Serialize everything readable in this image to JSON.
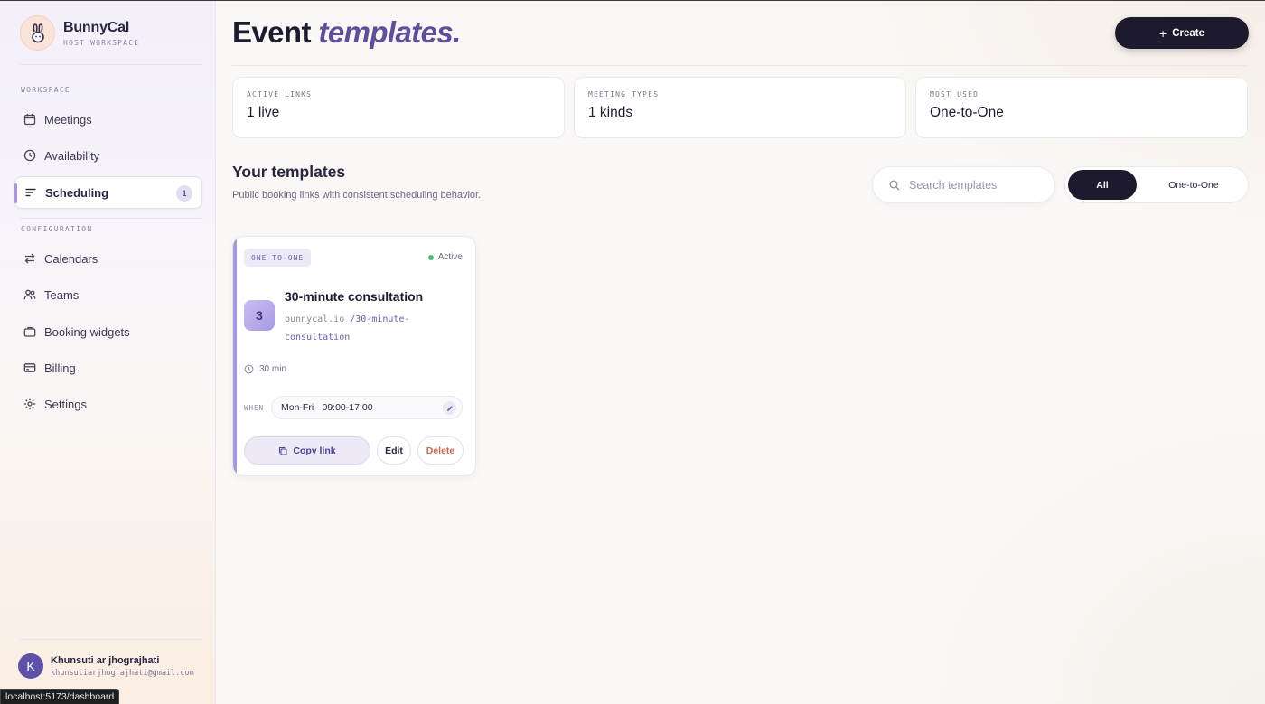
{
  "brand": {
    "name": "BunnyCal",
    "subtitle": "HOST WORKSPACE",
    "logo_icon": "bunny-icon"
  },
  "sidebar": {
    "section_workspace": "WORKSPACE",
    "section_configuration": "CONFIGURATION",
    "items": [
      {
        "label": "Meetings",
        "icon": "calendar-icon"
      },
      {
        "label": "Availability",
        "icon": "clock-icon"
      },
      {
        "label": "Scheduling",
        "icon": "list-icon",
        "active": true,
        "badge": "1"
      },
      {
        "label": "Calendars",
        "icon": "sync-arrows-icon"
      },
      {
        "label": "Teams",
        "icon": "users-icon"
      },
      {
        "label": "Booking widgets",
        "icon": "briefcase-icon"
      },
      {
        "label": "Billing",
        "icon": "credit-card-icon"
      },
      {
        "label": "Settings",
        "icon": "gear-icon"
      }
    ]
  },
  "user": {
    "initial": "K",
    "name": "Khunsuti ar jhograjhati",
    "email": "khunsutiarjhograjhati@gmail.com"
  },
  "status_bar": {
    "url": "localhost:5173/dashboard"
  },
  "header": {
    "title_plain": "Event",
    "title_accent": "templates.",
    "create_label": "Create"
  },
  "stats": [
    {
      "label": "ACTIVE LINKS",
      "value": "1 live"
    },
    {
      "label": "MEETING TYPES",
      "value": "1 kinds"
    },
    {
      "label": "MOST USED",
      "value": "One-to-One"
    }
  ],
  "templates_section": {
    "title": "Your templates",
    "subtitle": "Public booking links with consistent scheduling behavior.",
    "search_placeholder": "Search templates",
    "filters": [
      "All",
      "One-to-One"
    ],
    "active_filter": "All"
  },
  "template_card": {
    "type_tag": "ONE-TO-ONE",
    "status": "Active",
    "number": "3",
    "title": "30-minute consultation",
    "url_domain": "bunnycal.io",
    "url_slug": "/30-minute-consultation",
    "duration": "30 min",
    "when_label": "WHEN",
    "when_value": "Mon-Fri · 09:00-17:00",
    "copy_label": "Copy link",
    "edit_label": "Edit",
    "delete_label": "Delete"
  },
  "colors": {
    "accent": "#a797dd",
    "dark": "#1e1a2e",
    "danger": "#c6694b",
    "success": "#59b37a"
  }
}
